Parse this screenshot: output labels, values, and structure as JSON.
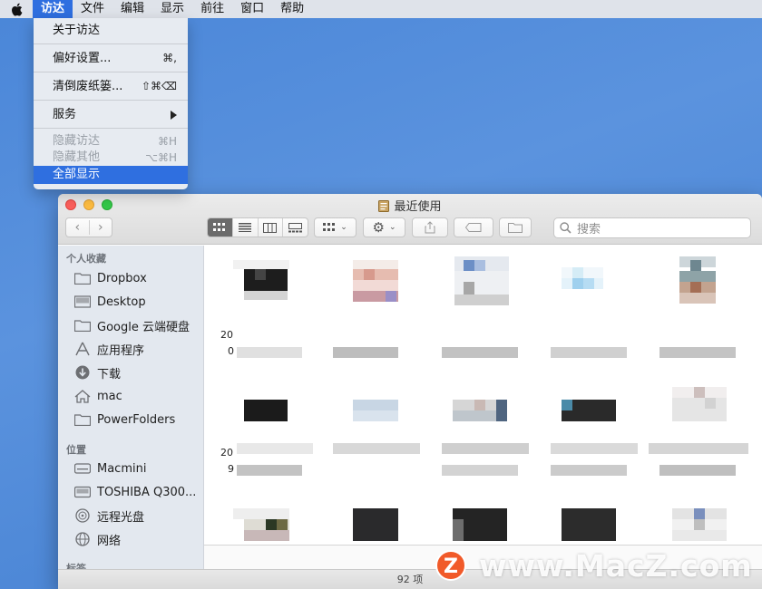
{
  "menubar": {
    "items": [
      "访达",
      "文件",
      "编辑",
      "显示",
      "前往",
      "窗口",
      "帮助"
    ]
  },
  "menu": {
    "about": "关于访达",
    "prefs": "偏好设置...",
    "prefs_sc": "⌘,",
    "empty_trash": "清倒废纸篓...",
    "empty_trash_sc": "⇧⌘⌫",
    "services": "服务",
    "hide": "隐藏访达",
    "hide_sc": "⌘H",
    "hide_others": "隐藏其他",
    "hide_others_sc": "⌥⌘H",
    "show_all": "全部显示"
  },
  "window": {
    "title": "最近使用",
    "search_placeholder": "搜索",
    "status": "92 项"
  },
  "sidebar": {
    "favorites_header": "个人收藏",
    "favorites": [
      {
        "label": "Dropbox",
        "icon": "folder-icon"
      },
      {
        "label": "Desktop",
        "icon": "desktop-icon"
      },
      {
        "label": "Google 云端硬盘",
        "icon": "folder-icon"
      },
      {
        "label": "应用程序",
        "icon": "applications-icon"
      },
      {
        "label": "下载",
        "icon": "download-icon"
      },
      {
        "label": "mac",
        "icon": "home-icon"
      },
      {
        "label": "PowerFolders",
        "icon": "folder-icon"
      }
    ],
    "locations_header": "位置",
    "locations": [
      {
        "label": "Macmini",
        "icon": "computer-icon"
      },
      {
        "label": "TOSHIBA Q300...",
        "icon": "drive-icon"
      },
      {
        "label": "远程光盘",
        "icon": "disc-icon"
      },
      {
        "label": "网络",
        "icon": "network-icon"
      }
    ],
    "tags_header": "标签"
  },
  "content": {
    "caption_fragments": [
      "20",
      "0",
      "20",
      "9"
    ]
  },
  "watermark": {
    "logo": "Z",
    "text": "www.MacZ.com"
  },
  "colors": {
    "accent": "#2f6fe0",
    "desktop": "#4a86d8"
  }
}
